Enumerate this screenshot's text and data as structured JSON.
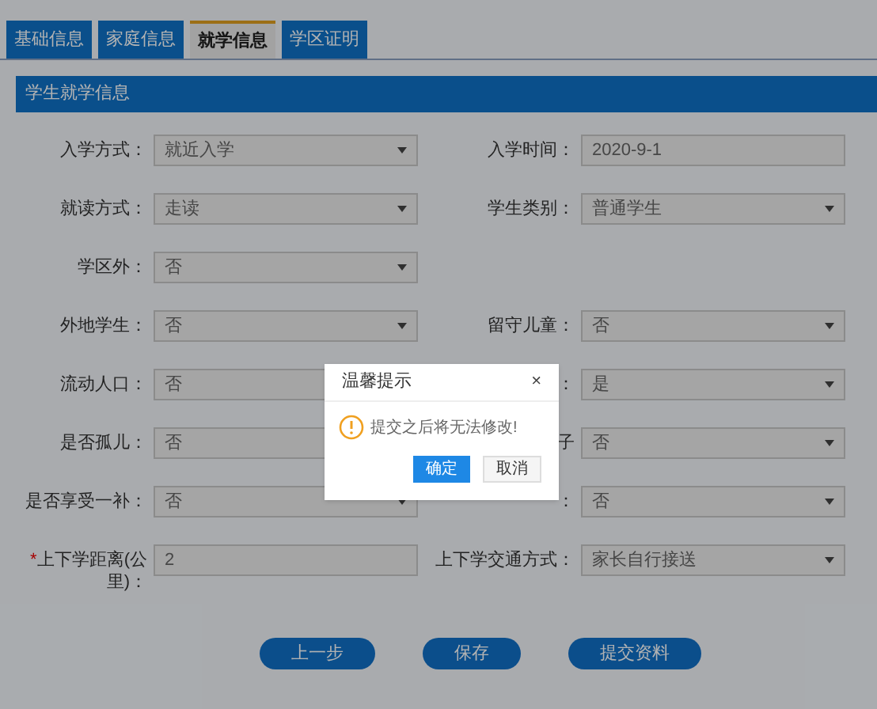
{
  "tabs": [
    {
      "label": "基础信息",
      "selected": false
    },
    {
      "label": "家庭信息",
      "selected": false
    },
    {
      "label": "就学信息",
      "selected": true
    },
    {
      "label": "学区证明",
      "selected": false
    }
  ],
  "section": {
    "title": "学生就学信息"
  },
  "form": {
    "rows": [
      {
        "left": {
          "label": "入学方式：",
          "kind": "select",
          "value": "就近入学"
        },
        "right": {
          "label": "入学时间：",
          "kind": "text",
          "value": "2020-9-1"
        }
      },
      {
        "left": {
          "label": "就读方式：",
          "kind": "select",
          "value": "走读"
        },
        "right": {
          "label": "学生类别：",
          "kind": "select",
          "value": "普通学生"
        }
      },
      {
        "left": {
          "label": "学区外：",
          "kind": "select",
          "value": "否"
        }
      },
      {
        "left": {
          "label": "外地学生：",
          "kind": "select",
          "value": "否"
        },
        "right": {
          "label": "留守儿童：",
          "kind": "select",
          "value": "否"
        }
      },
      {
        "left": {
          "label": "流动人口：",
          "kind": "select",
          "value": "否"
        },
        "right": {
          "label": "：",
          "kind": "select",
          "value": "是"
        }
      },
      {
        "left": {
          "label": "是否孤儿：",
          "kind": "select",
          "value": "否"
        },
        "right": {
          "label": "子",
          "kind": "select",
          "value": "否"
        }
      },
      {
        "left": {
          "label": "是否享受一补：",
          "kind": "select",
          "value": "否"
        },
        "right": {
          "label": "：",
          "kind": "select",
          "value": "否"
        }
      },
      {
        "left": {
          "label": "上下学距离(公里)：",
          "required_mark": "*",
          "kind": "text",
          "value": "2"
        },
        "right": {
          "label": "上下学交通方式：",
          "kind": "select",
          "value": "家长自行接送"
        }
      }
    ]
  },
  "buttons": [
    {
      "label": "上一步"
    },
    {
      "label": "保存"
    },
    {
      "label": "提交资料"
    }
  ],
  "dialog": {
    "title": "温馨提示",
    "close": "×",
    "message": "提交之后将无法修改!",
    "buttons": [
      {
        "label": "确定",
        "primary": true
      },
      {
        "label": "取消",
        "primary": false
      }
    ]
  }
}
